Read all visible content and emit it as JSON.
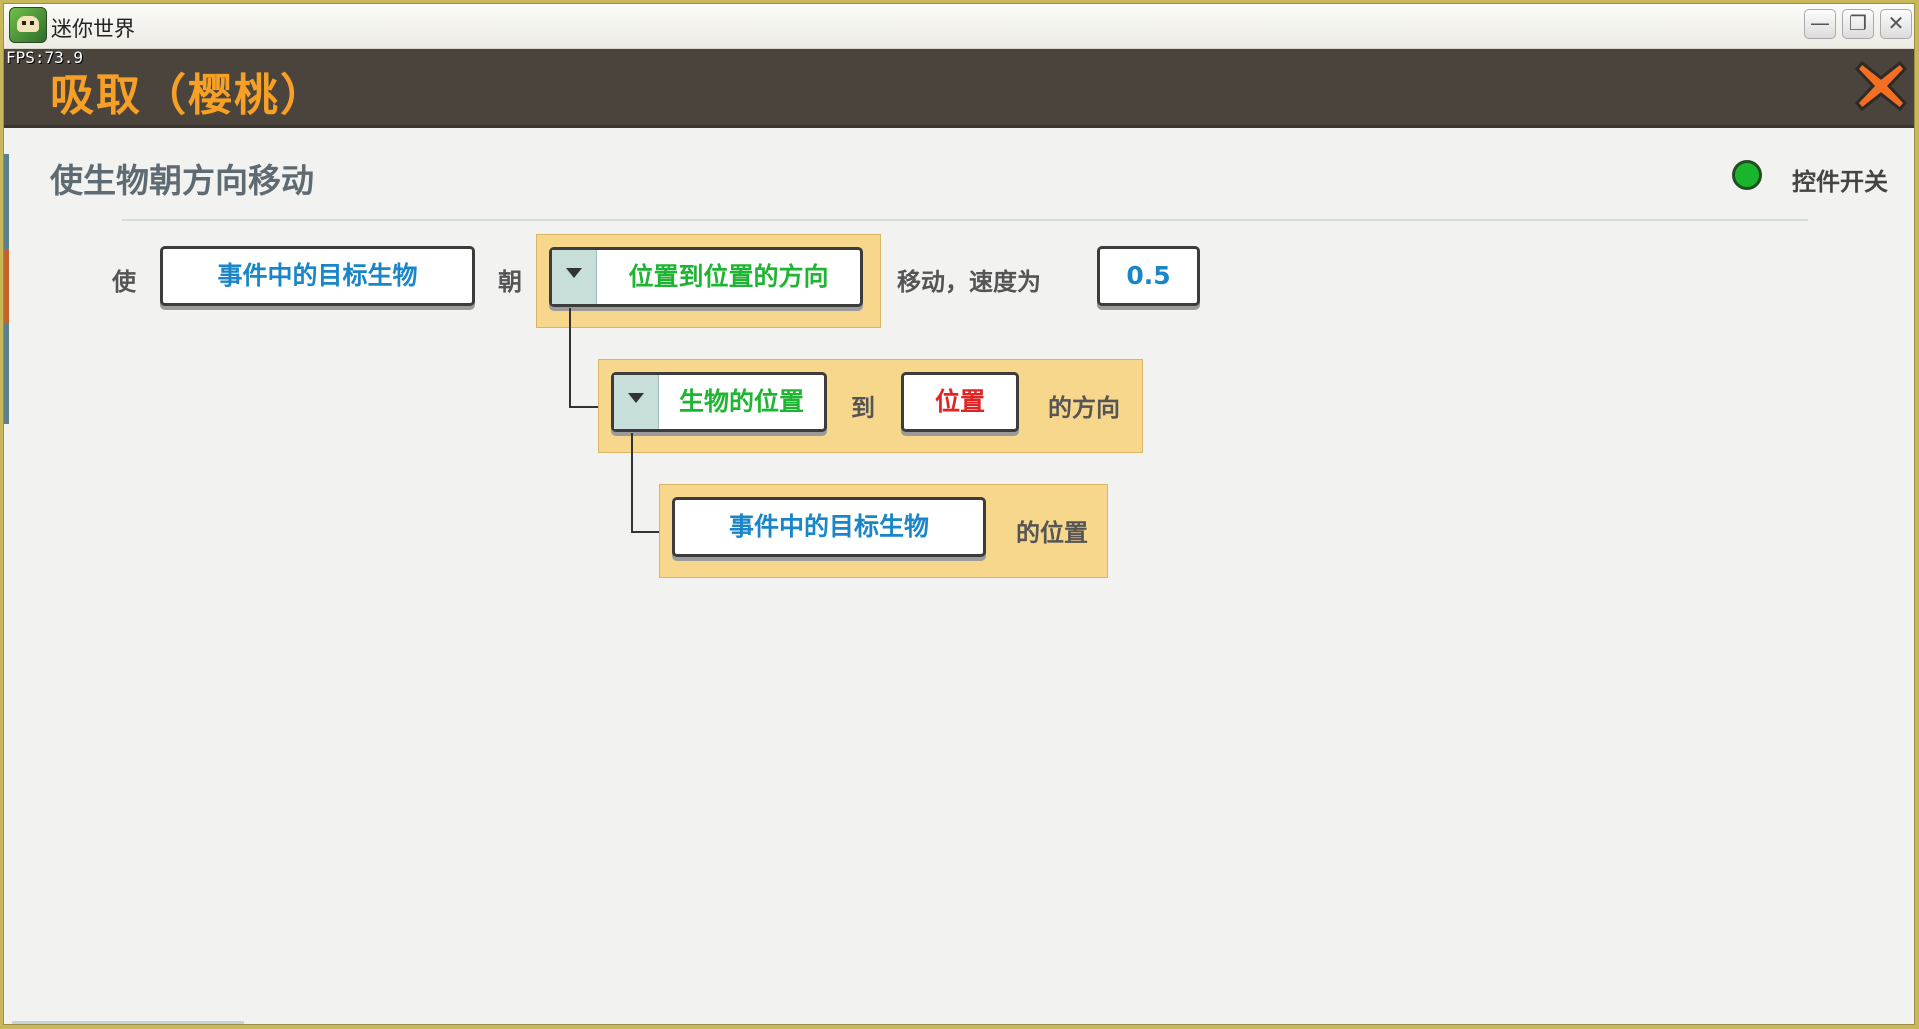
{
  "window": {
    "app_title": "迷你世界",
    "fps": "FPS:73.9"
  },
  "dialog": {
    "title": "吸取（樱桃）"
  },
  "action": {
    "title": "使生物朝方向移动",
    "toggle_label": "控件开关",
    "toggle_color": "#19b52c"
  },
  "row1": {
    "prefix": "使",
    "subject": "事件中的目标生物",
    "toward": "朝",
    "direction": "位置到位置的方向",
    "move_speed": "移动，速度为",
    "speed": "0.5"
  },
  "row2": {
    "from": "生物的位置",
    "to": "到",
    "target": "位置",
    "suffix": "的方向"
  },
  "row3": {
    "subject": "事件中的目标生物",
    "suffix": "的位置"
  },
  "colors": {
    "title_orange": "#f7a025",
    "param_blue": "#1a86c8",
    "param_green": "#1fb533",
    "param_red": "#e02424",
    "panel_yellow": "#f6d78c"
  }
}
